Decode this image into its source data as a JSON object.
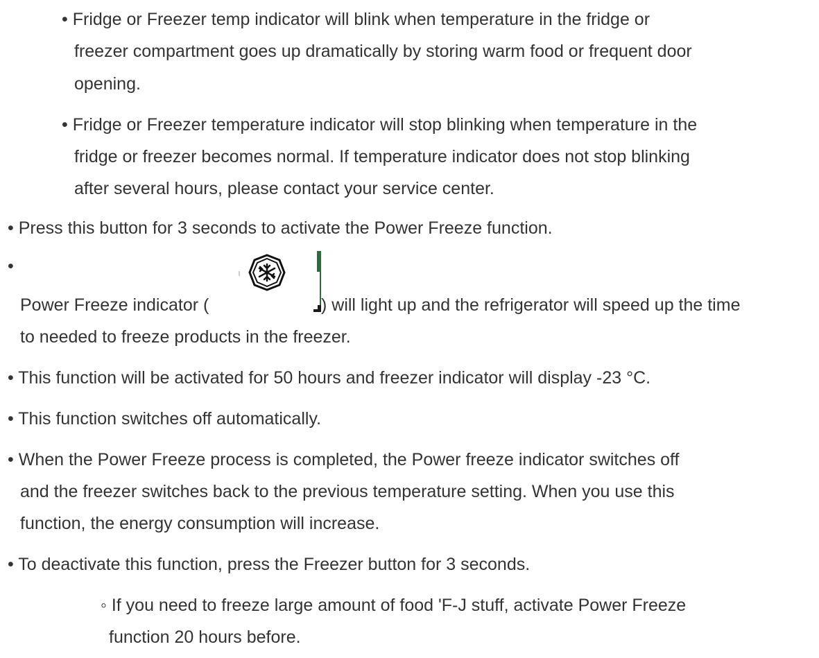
{
  "items": [
    {
      "bullet": "•",
      "lines": [
        "Fridge or Freezer temp indicator will blink when temperature in the fridge or",
        "freezer compartment goes up dramatically by storing warm food or frequent door",
        "opening."
      ]
    },
    {
      "bullet": "•",
      "lines": [
        "Fridge or Freezer temperature indicator will stop blinking when temperature in the",
        "fridge or freezer becomes normal. If temperature indicator does not stop blinking",
        "after several hours, please contact your service center."
      ]
    },
    {
      "bullet": "•",
      "lines": [
        "Press this button for 3 seconds to activate the Power Freeze function."
      ]
    },
    {
      "bullet": "•",
      "lines": [
        "Power Freeze indicator (",
        ") will light up and the refrigerator will speed up the time",
        "to needed to freeze products in the freezer."
      ]
    },
    {
      "bullet": "•",
      "lines": [
        "This function will be activated for 50 hours and freezer indicator will display -23 °C."
      ]
    },
    {
      "bullet": "•",
      "lines": [
        "This function switches off automatically."
      ]
    },
    {
      "bullet": "•",
      "lines": [
        "When the Power Freeze process is completed, the Power freeze indicator switches off",
        "and the freezer switches back to the previous temperature setting. When you use this",
        "function, the energy consumption will increase."
      ]
    },
    {
      "bullet": "•",
      "lines": [
        "To deactivate this function, press the Freezer button for 3 seconds."
      ]
    },
    {
      "bullet": "◦",
      "lines": [
        "If you need to freeze large amount of food 'F-J stuff, activate Power Freeze",
        "function 20 hours before."
      ]
    }
  ],
  "icons": {
    "power_freeze": "snowflake-hexagon-icon",
    "accent_color": "#2e6b3a"
  }
}
